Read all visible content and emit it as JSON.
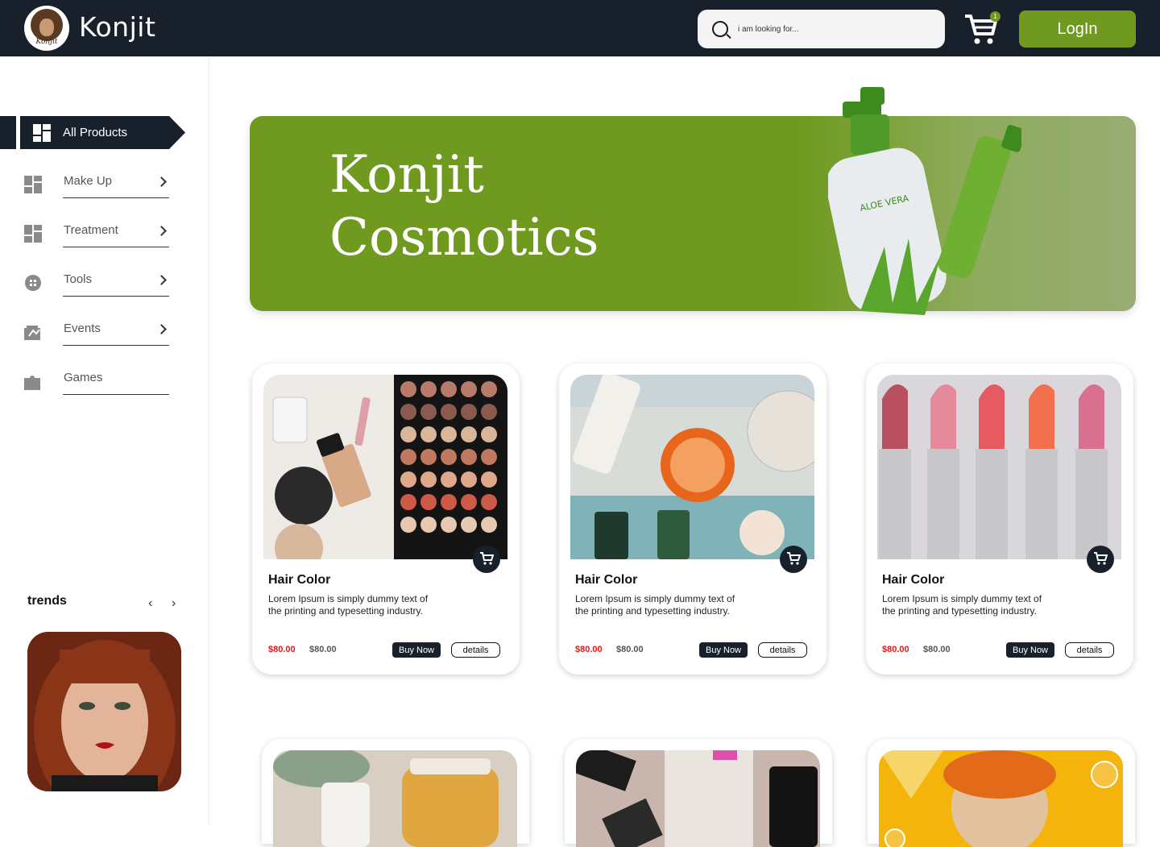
{
  "header": {
    "brand": "Konjit",
    "logo_text": "Konjit",
    "search_placeholder": "i am looking for...",
    "cart_count": "1",
    "login_label": "LogIn"
  },
  "sidebar": {
    "active_label": "All Products",
    "items": [
      {
        "label": "Make Up",
        "icon": "grid-icon"
      },
      {
        "label": "Treatment",
        "icon": "grid-icon"
      },
      {
        "label": "Tools",
        "icon": "tools-icon"
      },
      {
        "label": "Events",
        "icon": "events-icon"
      },
      {
        "label": "Games",
        "icon": "puzzle-icon"
      }
    ],
    "trends_title": "trends",
    "trends_prev": "‹",
    "trends_next": "›"
  },
  "hero": {
    "line1": "Konjit",
    "line2": "Cosmotics",
    "bottle_label": "ALOE VERA"
  },
  "products": [
    {
      "title": "Hair Color",
      "desc": "Lorem Ipsum is simply dummy text of the printing and typesetting industry.",
      "price_sale": "$80.00",
      "price_regular": "$80.00",
      "buy_label": "Buy Now",
      "details_label": "details"
    },
    {
      "title": "Hair Color",
      "desc": "Lorem Ipsum is simply dummy text of the printing and typesetting industry.",
      "price_sale": "$80.00",
      "price_regular": "$80.00",
      "buy_label": "Buy Now",
      "details_label": "details"
    },
    {
      "title": "Hair Color",
      "desc": "Lorem Ipsum is simply dummy text of the printing and typesetting industry.",
      "price_sale": "$80.00",
      "price_regular": "$80.00",
      "buy_label": "Buy Now",
      "details_label": "details"
    }
  ],
  "colors": {
    "brand_green": "#6f9a1f",
    "dark": "#18212b",
    "sale_red": "#e01818"
  }
}
